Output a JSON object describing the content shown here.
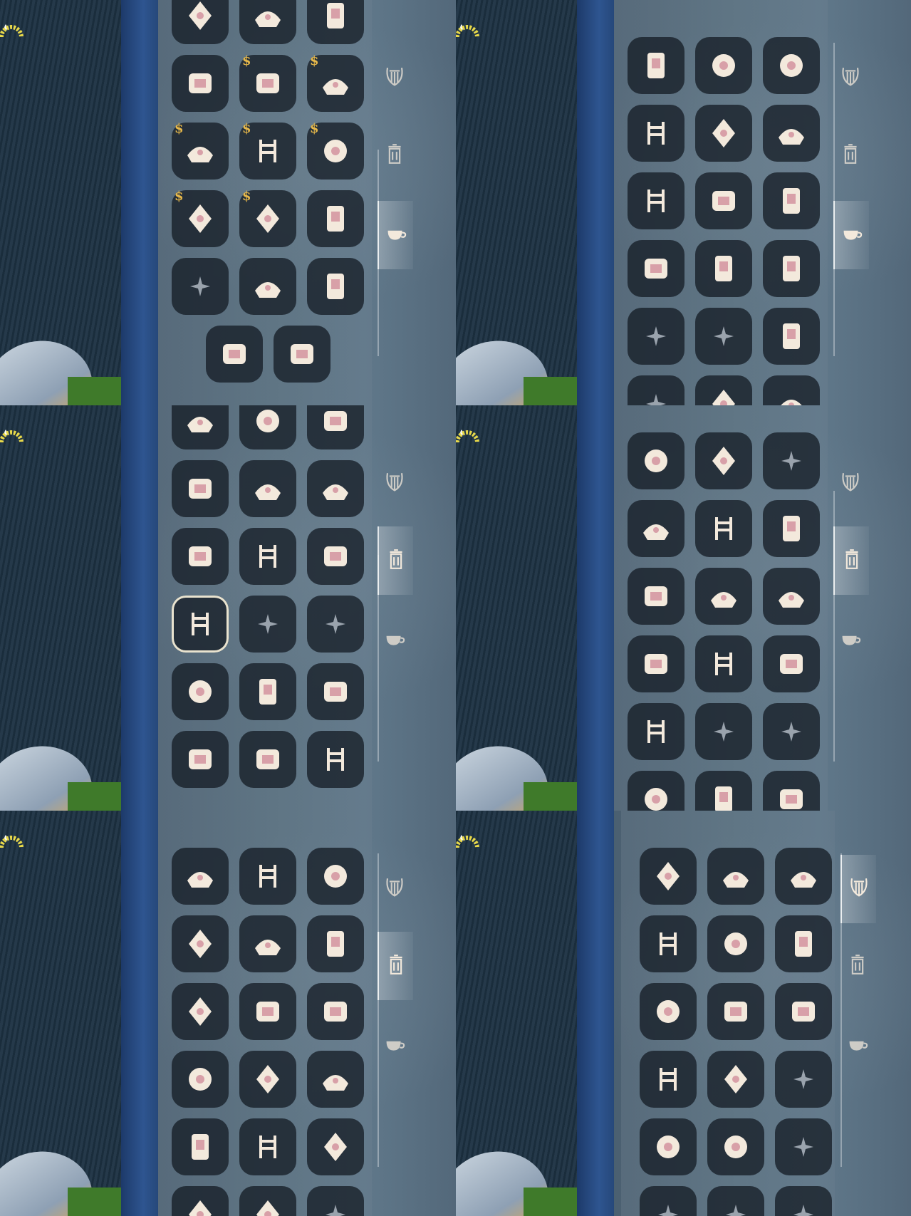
{
  "ui": {
    "help_label": "?",
    "close_label": "✕"
  },
  "colors": {
    "slot_bg": "#161e26",
    "icon_cream": "#f3e9dc",
    "icon_pink": "#d8a0a8",
    "lock_gold": "#e8b94a",
    "sparkle": "#9aa3ad"
  },
  "tabs": [
    {
      "name": "instruments",
      "icon": "lyre-icon"
    },
    {
      "name": "furniture",
      "icon": "trash-can-icon"
    },
    {
      "name": "props",
      "icon": "teacup-icon"
    }
  ],
  "panes": [
    {
      "active_tab": 2,
      "scroll_start": 0.5,
      "rows": [
        [
          "picture-frame-icon",
          "wine-glass-icon",
          "picnic-basket-icon"
        ],
        [
          "cat-cushion-icon",
          "music-banner-icon",
          "piano-banner-icon"
        ],
        [
          "banner-icon",
          "card-banner-icon",
          "keyboard-icon"
        ],
        [
          "grand-piano-icon",
          "grand-piano-icon",
          "diamond-rug-icon"
        ],
        [
          "sparkle-icon",
          "pinwheel-icon",
          "flower-pot-icon"
        ],
        [
          "torch-icon",
          "balloons-icon"
        ]
      ],
      "locked": [
        [
          1,
          1
        ],
        [
          1,
          2
        ],
        [
          2,
          0
        ],
        [
          2,
          1
        ],
        [
          2,
          2
        ],
        [
          3,
          0
        ],
        [
          3,
          1
        ]
      ]
    },
    {
      "active_tab": 2,
      "scroll_start": 0,
      "rows": [
        [
          "hexagon-tile-icon",
          "jar-icon",
          "cushion-icon"
        ],
        [
          "rose-icon",
          "cake-icon",
          "pinwheel-icon"
        ],
        [
          "bunting-icon",
          "balloons-icon",
          "horn-icon"
        ],
        [
          "pumpkin-icon",
          "pillow-icon",
          "snow-globe-icon"
        ],
        [
          "sparkle-icon",
          "sparkle-icon",
          "music-box-icon"
        ],
        [
          "sparkle-icon",
          "checker-rug-icon",
          "mat-icon"
        ]
      ],
      "locked": []
    },
    {
      "active_tab": 1,
      "scroll_start": 0.5,
      "rows": [
        [
          "table-icon",
          "stool-icon",
          "lamp-icon"
        ],
        [
          "flower-arch-icon",
          "umbrella-icon",
          "lounger-icon"
        ],
        [
          "adirondack-chair-icon",
          "deck-chair-icon",
          "throne-icon"
        ],
        [
          "rocking-chair-icon",
          "sparkle-icon",
          "sparkle-icon"
        ],
        [
          "stool-icon",
          "bed-icon",
          "turtle-icon"
        ],
        [
          "hanging-plant-icon",
          "lantern-icon",
          "table-lamp-icon"
        ]
      ],
      "locked": [],
      "selected": [
        3,
        0
      ]
    },
    {
      "active_tab": 1,
      "scroll_start": 0.2,
      "rows": [
        [
          "spinner-icon",
          "swing-icon",
          "sparkle-icon"
        ],
        [
          "plant-table-icon",
          "tent-icon",
          "teapot-icon"
        ],
        [
          "flower-arch-icon",
          "umbrella-icon",
          "lounger-icon"
        ],
        [
          "adirondack-chair-icon",
          "deck-chair-icon",
          "throne-icon"
        ],
        [
          "rocking-chair-icon",
          "sparkle-icon",
          "sparkle-icon"
        ],
        [
          "stool-icon",
          "bed-icon",
          "turtle-icon"
        ]
      ],
      "locked": []
    },
    {
      "active_tab": 1,
      "scroll_start": 0,
      "rows": [
        [
          "donut-cushion-icon",
          "chair-icon",
          "vase-icon"
        ],
        [
          "bucket-icon",
          "pedestal-icon",
          "low-table-icon"
        ],
        [
          "sack-icon",
          "shelf-icon",
          "hammock-icon"
        ],
        [
          "broom-icon",
          "side-table-icon",
          "egg-lamp-icon"
        ],
        [
          "mirror-icon",
          "candle-icon",
          "potted-plant-icon"
        ],
        [
          "shell-icon",
          "swing-icon",
          "sparkle-icon"
        ]
      ],
      "locked": []
    },
    {
      "active_tab": 0,
      "scroll_start": 0,
      "rows": [
        [
          "flute-icon",
          "lantern-jar-icon",
          "drum-icon"
        ],
        [
          "djembe-icon",
          "firework-icon",
          "horn-icon"
        ],
        [
          "ocarina-icon",
          "lantern-icon",
          "parasol-icon"
        ],
        [
          "violin-icon",
          "guitar-icon",
          "sparkle-icon"
        ],
        [
          "speaker-icon",
          "speaker-icon",
          "sparkle-icon"
        ],
        [
          "sparkle-icon",
          "sparkle-icon",
          "sparkle-icon"
        ]
      ],
      "locked": []
    }
  ]
}
